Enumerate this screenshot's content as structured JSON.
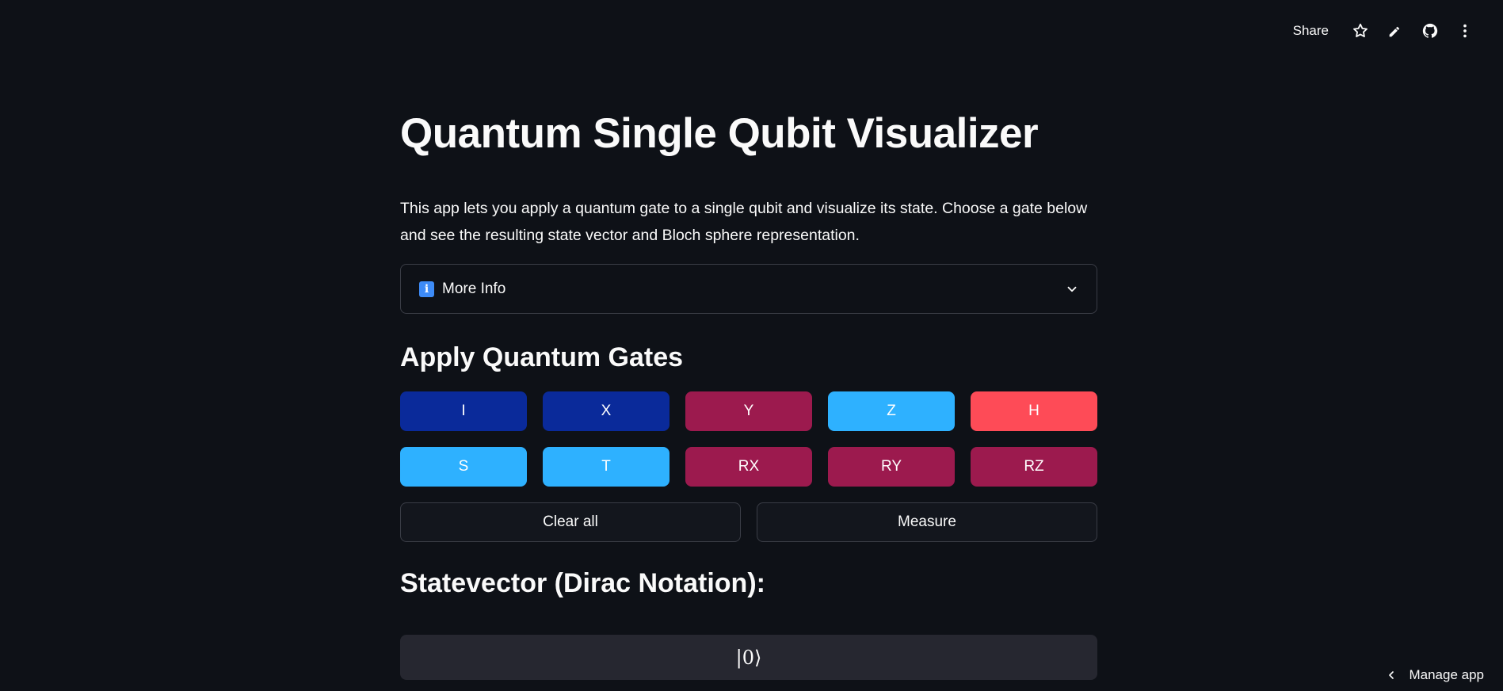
{
  "topbar": {
    "share_label": "Share",
    "icons": [
      "star-icon",
      "pencil-icon",
      "github-icon",
      "more-vertical-icon"
    ]
  },
  "title": "Quantum Single Qubit Visualizer",
  "intro": "This app lets you apply a quantum gate to a single qubit and visualize its state. Choose a gate below and see the resulting state vector and Bloch sphere representation.",
  "expander": {
    "icon": "info-icon",
    "icon_glyph": "i",
    "label": "More Info"
  },
  "gates_section": {
    "heading": "Apply Quantum Gates",
    "gates": [
      {
        "label": "I",
        "color": "#0a2a9a"
      },
      {
        "label": "X",
        "color": "#0a2a9a"
      },
      {
        "label": "Y",
        "color": "#9c1a4e"
      },
      {
        "label": "Z",
        "color": "#2eb1ff"
      },
      {
        "label": "H",
        "color": "#fe4b57"
      },
      {
        "label": "S",
        "color": "#2eb1ff"
      },
      {
        "label": "T",
        "color": "#2eb1ff"
      },
      {
        "label": "RX",
        "color": "#9c1a4e"
      },
      {
        "label": "RY",
        "color": "#9c1a4e"
      },
      {
        "label": "RZ",
        "color": "#9c1a4e"
      }
    ],
    "clear_label": "Clear all",
    "measure_label": "Measure"
  },
  "statevector": {
    "heading": "Statevector (Dirac Notation):",
    "value": "|0⟩"
  },
  "manage_app": {
    "label": "Manage app"
  },
  "colors": {
    "background": "#0e1117",
    "text": "#fafafa",
    "border": "#3a3d46",
    "code_bg": "#262730"
  }
}
